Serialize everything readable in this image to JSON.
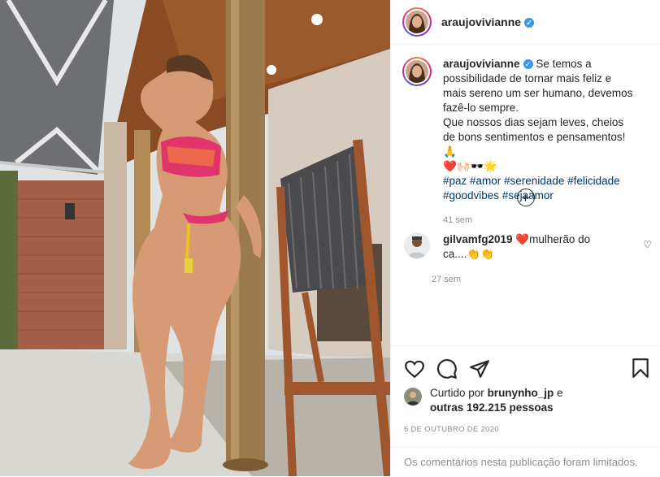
{
  "post": {
    "username": "araujovivianne",
    "caption": {
      "text_lines": [
        "Se temos a possibilidade de tornar mais feliz e mais sereno um ser humano, devemos fazê-lo sempre.",
        "Que nossos dias sejam leves, cheios de bons sentimentos e pensamentos! 🙏"
      ],
      "emojis": "❤️🙌🏻🕶️🌟",
      "hashtags": "#paz #amor #serenidade #felicidade #goodvibes #sejaamor",
      "time": "41 sem"
    },
    "more_button": "+",
    "comments": [
      {
        "username": "gilvamfg2019",
        "text": "❤️mulherão do ca....👏👏",
        "time": "27 sem"
      }
    ],
    "likes": {
      "prefix": "Curtido por",
      "first_liker": "brunynho_jp",
      "joiner": "e",
      "others": "outras 192.215 pessoas"
    },
    "date": "6 DE OUTUBRO DE 2020",
    "comments_limited": "Os comentários nesta publicação foram limitados.",
    "icons": [
      "heart-icon",
      "comment-icon",
      "share-icon",
      "bookmark-icon",
      "verified-icon",
      "plus-icon"
    ],
    "colors": {
      "verified": "#3897f0",
      "hashtag": "#00376b",
      "muted": "#8e8e8e"
    }
  }
}
